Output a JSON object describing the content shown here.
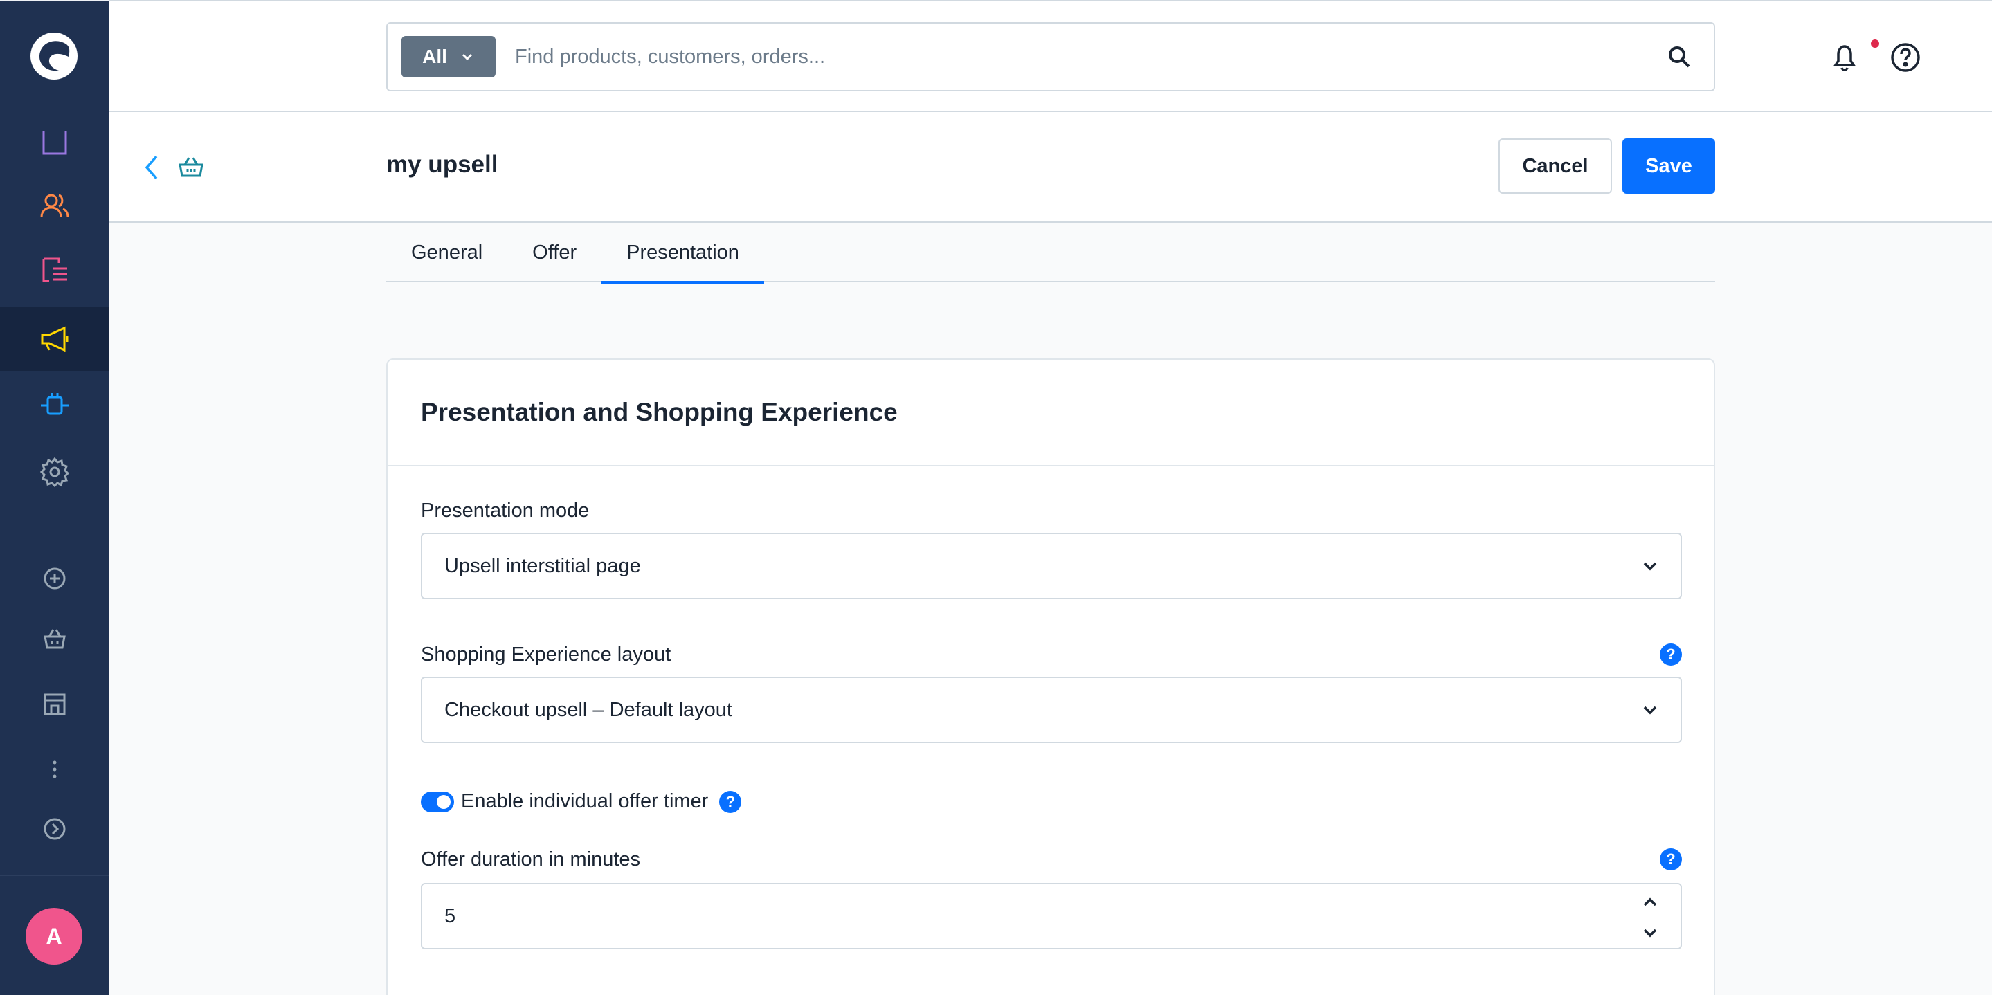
{
  "sidebar": {
    "items": [
      {
        "icon": "catalog-icon",
        "color": "#9a77e0"
      },
      {
        "icon": "customers-icon",
        "color": "#ff8846"
      },
      {
        "icon": "orders-icon",
        "color": "#f0558c"
      },
      {
        "icon": "marketing-icon",
        "color": "#ffd700",
        "active": true
      },
      {
        "icon": "extensions-icon",
        "color": "#189eff"
      },
      {
        "icon": "settings-icon",
        "color": "#9aa8b5"
      },
      {
        "icon": "add-icon",
        "color": "#9aa8b5"
      },
      {
        "icon": "basket-icon",
        "color": "#9aa8b5"
      },
      {
        "icon": "storefront-icon",
        "color": "#9aa8b5"
      },
      {
        "icon": "more-icon",
        "color": "#9aa8b5"
      },
      {
        "icon": "expand-icon",
        "color": "#9aa8b5"
      }
    ],
    "avatar_initial": "A"
  },
  "search": {
    "scope_label": "All",
    "placeholder": "Find products, customers, orders..."
  },
  "smartbar": {
    "title": "my upsell",
    "cancel_label": "Cancel",
    "save_label": "Save"
  },
  "tabs": [
    {
      "label": "General"
    },
    {
      "label": "Offer"
    },
    {
      "label": "Presentation",
      "active": true
    }
  ],
  "card": {
    "title": "Presentation and Shopping Experience",
    "presentation_mode": {
      "label": "Presentation mode",
      "value": "Upsell interstitial page"
    },
    "layout": {
      "label": "Shopping Experience layout",
      "value": "Checkout upsell – Default layout"
    },
    "timer": {
      "label": "Enable individual offer timer",
      "enabled": true
    },
    "duration": {
      "label": "Offer duration in minutes",
      "value": "5"
    },
    "help_glyph": "?"
  },
  "colors": {
    "accent": "#0870ff",
    "sidebar_bg": "#1f3151",
    "notification_dot": "#de294c"
  }
}
